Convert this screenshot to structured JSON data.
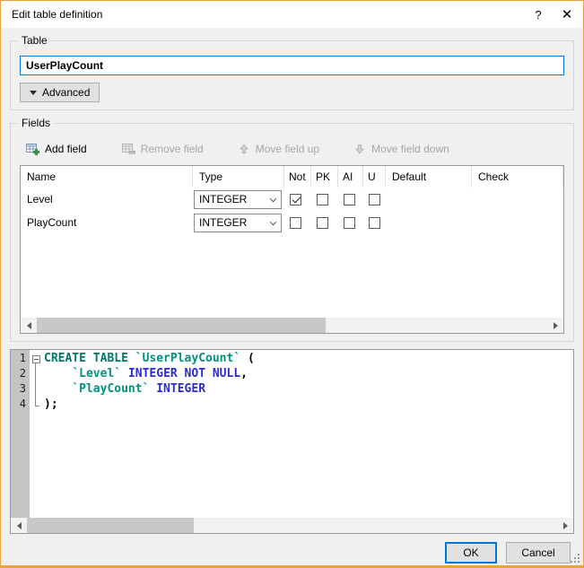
{
  "theme": {
    "accent_color": "#0078d7",
    "window_border_color": "#e8a33d",
    "titlebar_bg": "#ffffff",
    "dialog_bg": "#f0f0f0"
  },
  "window": {
    "title": "Edit table definition",
    "help_label": "?",
    "close_label": "✕"
  },
  "table_group": {
    "label": "Table",
    "name_value": "UserPlayCount",
    "advanced_label": "Advanced"
  },
  "fields_group": {
    "label": "Fields",
    "toolbar": {
      "add_field": "Add field",
      "remove_field": "Remove field",
      "move_field_up": "Move field up",
      "move_field_down": "Move field down"
    },
    "columns": [
      "Name",
      "Type",
      "Not",
      "PK",
      "AI",
      "U",
      "Default",
      "Check"
    ],
    "rows": [
      {
        "name": "Level",
        "type": "INTEGER",
        "not_null": true,
        "pk": false,
        "ai": false,
        "unique": false,
        "default": "",
        "check": ""
      },
      {
        "name": "PlayCount",
        "type": "INTEGER",
        "not_null": false,
        "pk": false,
        "ai": false,
        "unique": false,
        "default": "",
        "check": ""
      }
    ]
  },
  "sql_preview": {
    "styles": {
      "keyword": "#00756e",
      "identifier": "#00917f",
      "type": "#2b2bcf",
      "plain": "#000000"
    },
    "lines": [
      {
        "num": "1",
        "fold": "start",
        "segments": [
          {
            "text": "CREATE TABLE ",
            "style": "keyword"
          },
          {
            "text": "`UserPlayCount`",
            "style": "identifier"
          },
          {
            "text": " (",
            "style": "plain"
          }
        ]
      },
      {
        "num": "2",
        "fold": "line",
        "segments": [
          {
            "text": "    ",
            "style": "plain"
          },
          {
            "text": "`Level`",
            "style": "identifier"
          },
          {
            "text": " ",
            "style": "plain"
          },
          {
            "text": "INTEGER NOT NULL",
            "style": "type"
          },
          {
            "text": ",",
            "style": "plain"
          }
        ]
      },
      {
        "num": "3",
        "fold": "line",
        "segments": [
          {
            "text": "    ",
            "style": "plain"
          },
          {
            "text": "`PlayCount`",
            "style": "identifier"
          },
          {
            "text": " ",
            "style": "plain"
          },
          {
            "text": "INTEGER",
            "style": "type"
          }
        ]
      },
      {
        "num": "4",
        "fold": "end",
        "segments": [
          {
            "text": ");",
            "style": "plain"
          }
        ]
      }
    ]
  },
  "footer": {
    "ok_label": "OK",
    "cancel_label": "Cancel"
  }
}
